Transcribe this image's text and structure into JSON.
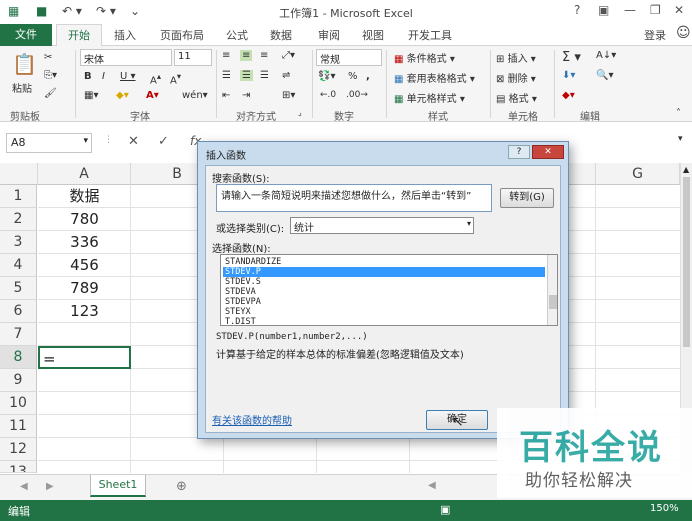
{
  "window": {
    "title": "工作簿1 - Microsoft Excel"
  },
  "tabs": {
    "file": "文件",
    "items": [
      "开始",
      "插入",
      "页面布局",
      "公式",
      "数据",
      "审阅",
      "视图",
      "开发工具"
    ],
    "login": "登录"
  },
  "ribbon": {
    "font_name": "宋体",
    "font_size": "11",
    "number_format": "常规",
    "paste_label": "粘贴",
    "clipboard_label": "剪贴板",
    "font_label": "字体",
    "align_label": "对齐方式",
    "number_label": "数字",
    "styles_label": "样式",
    "cells_label": "单元格",
    "edit_label": "编辑",
    "cond_format": "条件格式",
    "table_format": "套用表格格式",
    "cell_style": "单元格样式",
    "insert": "插入",
    "delete": "删除",
    "format": "格式"
  },
  "formula_bar": {
    "name_box": "A8",
    "fx": "fx"
  },
  "grid": {
    "columns": [
      "A",
      "B",
      "C",
      "D",
      "E",
      "F",
      "G"
    ],
    "rows": [
      "1",
      "2",
      "3",
      "4",
      "5",
      "6",
      "7",
      "8",
      "9",
      "10",
      "11",
      "12",
      "13"
    ],
    "a_cells": [
      "数据",
      "780",
      "336",
      "456",
      "789",
      "123",
      "",
      "="
    ]
  },
  "sheet": {
    "tab": "Sheet1",
    "add_icon": "plus-icon"
  },
  "status": {
    "mode": "编辑",
    "zoom": "150%"
  },
  "dialog": {
    "title": "插入函数",
    "search_label": "搜索函数(S):",
    "search_value": "请输入一条简短说明来描述您想做什么，然后单击“转到”",
    "goto_button": "转到(G)",
    "category_label": "或选择类别(C):",
    "category_value": "统计",
    "function_label": "选择函数(N):",
    "functions": [
      "STANDARDIZE",
      "STDEV.P",
      "STDEV.S",
      "STDEVA",
      "STDEVPA",
      "STEYX",
      "T.DIST"
    ],
    "selected_index": 1,
    "syntax": "STDEV.P(number1,number2,...)",
    "description": "计算基于给定的样本总体的标准偏差(忽略逻辑值及文本)",
    "help_link": "有关该函数的帮助",
    "ok_button": "确定"
  },
  "watermark": {
    "title": "百科全说",
    "subtitle": "助你轻松解决"
  }
}
